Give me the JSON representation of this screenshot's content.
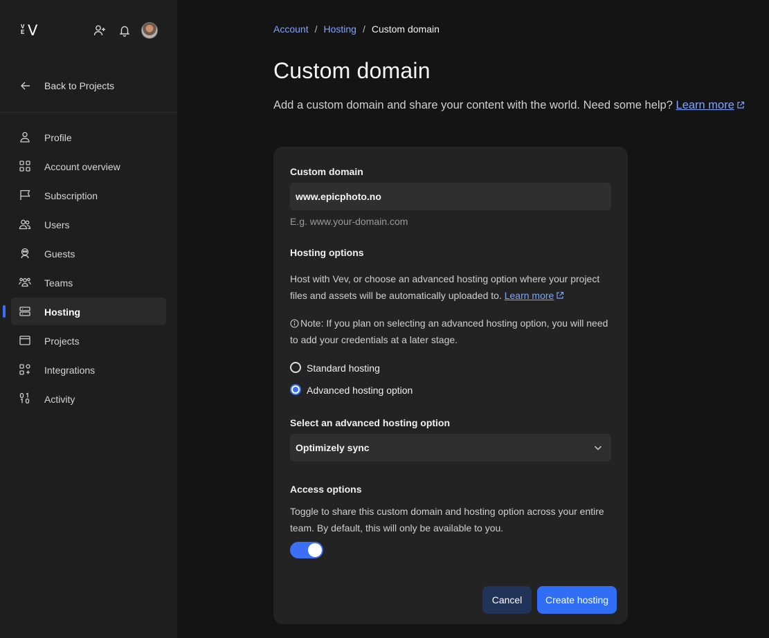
{
  "brand": {
    "logo_small_top": "V",
    "logo_small_bottom": "E",
    "logo_big": "V"
  },
  "topbar": {
    "invite_icon": "user-plus-icon",
    "notifications_icon": "bell-icon"
  },
  "sidebar": {
    "back_label": "Back to Projects",
    "items": [
      {
        "label": "Profile",
        "icon": "user-icon"
      },
      {
        "label": "Account overview",
        "icon": "grid-icon"
      },
      {
        "label": "Subscription",
        "icon": "flag-icon"
      },
      {
        "label": "Users",
        "icon": "users-icon"
      },
      {
        "label": "Guests",
        "icon": "guest-icon"
      },
      {
        "label": "Teams",
        "icon": "teams-icon"
      },
      {
        "label": "Hosting",
        "icon": "server-icon",
        "active": true
      },
      {
        "label": "Projects",
        "icon": "browser-window-icon"
      },
      {
        "label": "Integrations",
        "icon": "integrations-icon"
      },
      {
        "label": "Activity",
        "icon": "binary-icon"
      }
    ]
  },
  "breadcrumb": {
    "items": [
      "Account",
      "Hosting"
    ],
    "current": "Custom domain",
    "separator": "/"
  },
  "page": {
    "title": "Custom domain",
    "subtitle": "Add a custom domain and share your content with the world. Need some help?",
    "subtitle_link": "Learn more"
  },
  "form": {
    "domain_label": "Custom domain",
    "domain_value": "www.epicphoto.no",
    "domain_hint": "E.g. www.your-domain.com",
    "hosting_heading": "Hosting options",
    "hosting_desc": "Host with Vev, or choose an advanced hosting option where your project files and assets will be automatically uploaded to.",
    "hosting_link": "Learn more",
    "note": "Note: If you plan on selecting an advanced hosting option, you will need to add your credentials at a later stage.",
    "radio_standard": "Standard hosting",
    "radio_advanced": "Advanced hosting option",
    "selected_radio": "Advanced hosting option",
    "select_label": "Select an advanced hosting option",
    "select_value": "Optimizely sync",
    "access_heading": "Access options",
    "access_desc": "Toggle to share this custom domain and hosting option across your entire team. By default, this will only be available to you.",
    "toggle_on": true,
    "cancel_label": "Cancel",
    "create_label": "Create hosting"
  },
  "colors": {
    "accent": "#3b6ff5",
    "link": "#7ea5ff",
    "background": "#141414",
    "sidebar": "#1e1e1e",
    "card": "#232323"
  }
}
